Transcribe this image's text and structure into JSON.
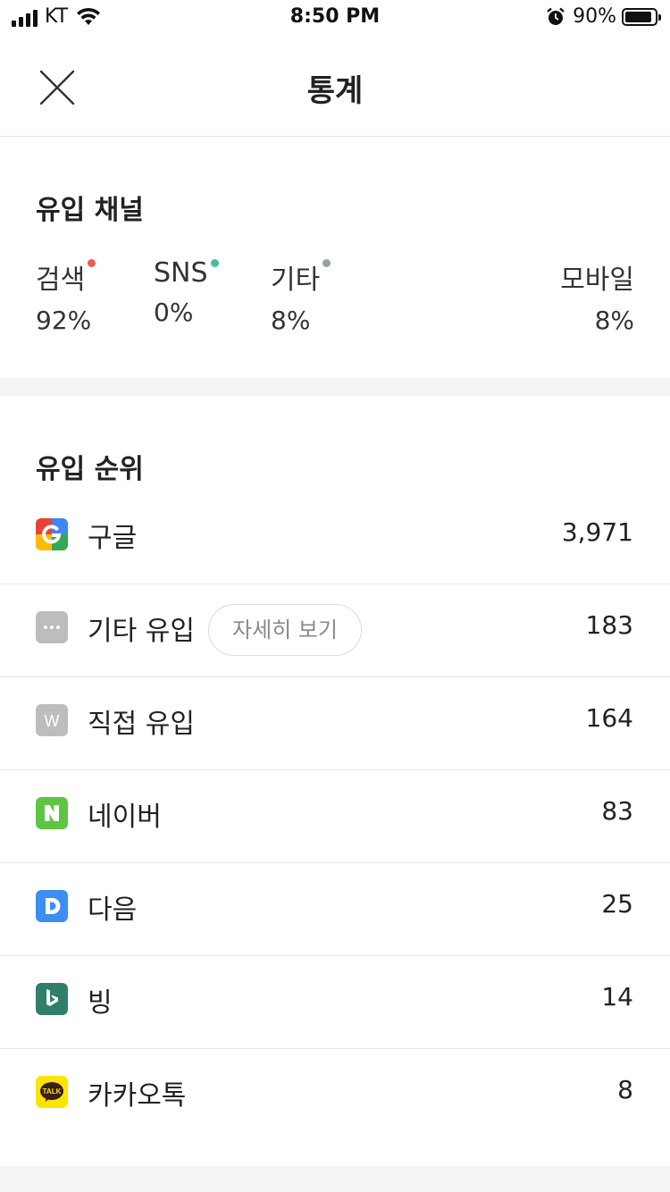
{
  "status_bar": {
    "carrier": "KT",
    "time": "8:50 PM",
    "battery_percent": "90%",
    "battery_level": 0.9
  },
  "header": {
    "title": "통계",
    "close_icon": "close-icon"
  },
  "inflow_channel": {
    "title": "유입 채널",
    "channels": [
      {
        "name": "검색",
        "value": "92%",
        "dot_color": "#e8604c"
      },
      {
        "name": "SNS",
        "value": "0%",
        "dot_color": "#3fbfa6"
      },
      {
        "name": "기타",
        "value": "8%",
        "dot_color": "#9aa0a8"
      }
    ],
    "mobile": {
      "name": "모바일",
      "value": "8%"
    }
  },
  "inflow_rank": {
    "title": "유입 순위",
    "detail_button": "자세히 보기",
    "items": [
      {
        "icon": "google-icon",
        "label": "구글",
        "count": "3,971"
      },
      {
        "icon": "more-dots-icon",
        "label": "기타 유입",
        "count": "183"
      },
      {
        "icon": "direct-w-icon",
        "label": "직접 유입",
        "count": "164",
        "icon_text": "W"
      },
      {
        "icon": "naver-icon",
        "label": "네이버",
        "count": "83"
      },
      {
        "icon": "daum-icon",
        "label": "다음",
        "count": "25"
      },
      {
        "icon": "bing-icon",
        "label": "빙",
        "count": "14"
      },
      {
        "icon": "kakaotalk-icon",
        "label": "카카오톡",
        "count": "8",
        "icon_text": "TALK"
      }
    ]
  },
  "colors": {
    "google_blue": "#4285f4",
    "naver_green": "#5ec542",
    "daum_blue": "#3d8ef0",
    "bing_teal": "#2f7f6b",
    "kakao_yellow": "#fde500",
    "gray_icon": "#bdbdbd"
  }
}
